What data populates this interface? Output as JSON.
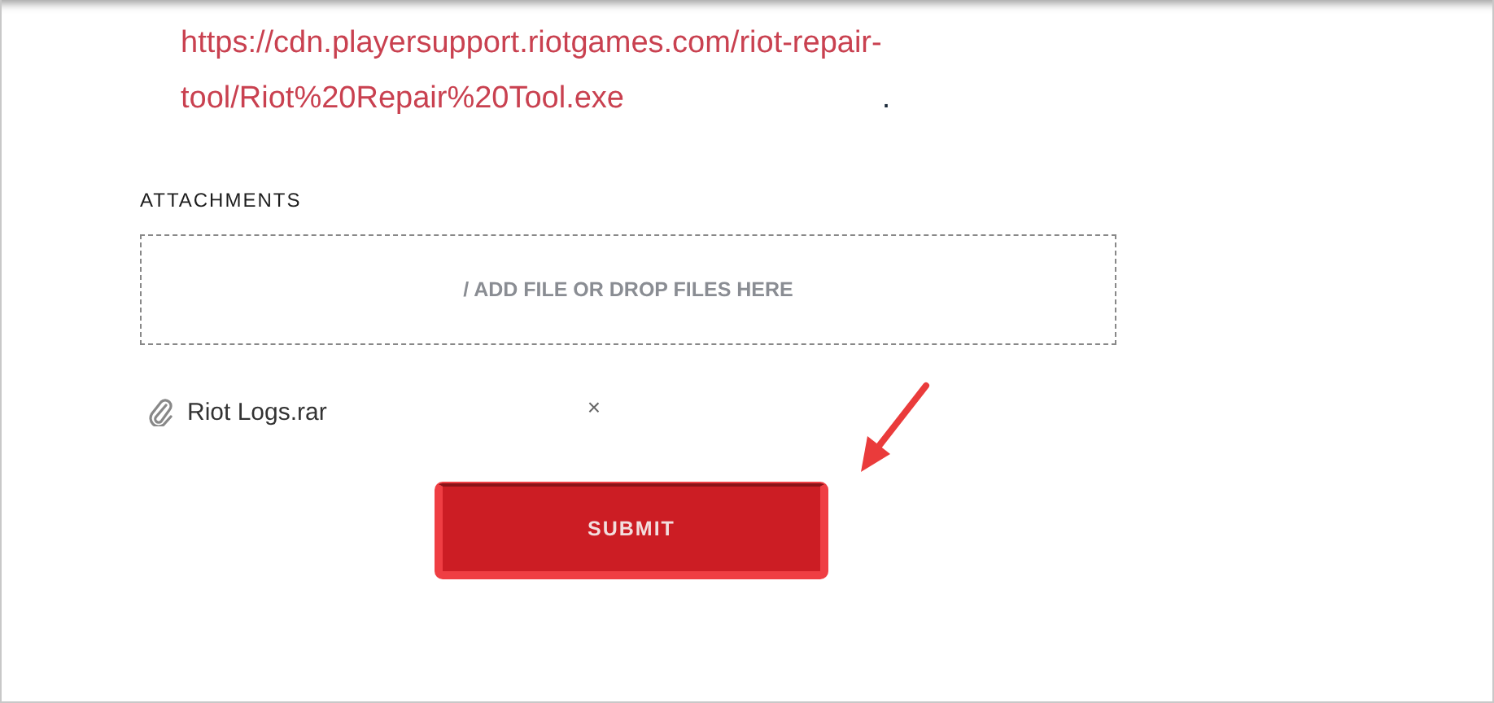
{
  "link": {
    "lines": [
      "https://cdn.playersupport.riotgames.com/riot-repair-",
      "tool/Riot%20Repair%20Tool.exe"
    ],
    "trailing": "."
  },
  "attachments": {
    "label": "ATTACHMENTS",
    "dropzone": "/ ADD FILE OR DROP FILES HERE",
    "files": [
      {
        "name": "Riot Logs.rar",
        "remove": "×"
      }
    ]
  },
  "submit": "SUBMIT"
}
